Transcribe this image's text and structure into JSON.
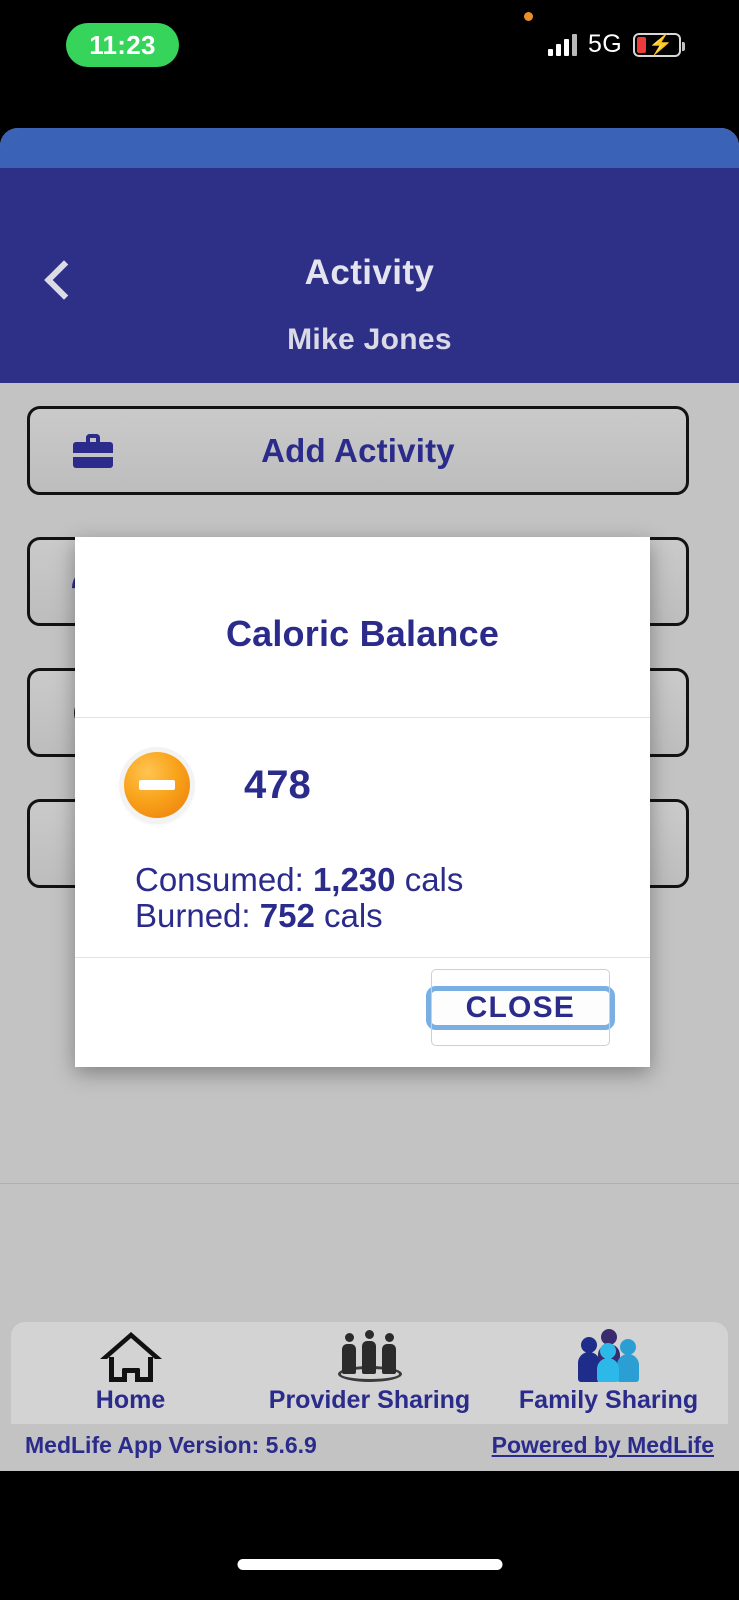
{
  "status_bar": {
    "time": "11:23",
    "network": "5G",
    "signal_icon": "signal-bars-icon",
    "battery_icon": "battery-charging-icon",
    "recording_indicator": "orange-dot-icon"
  },
  "header": {
    "back_icon": "back-chevron-icon",
    "title": "Activity",
    "subtitle": "Mike Jones"
  },
  "cards": [
    {
      "label": "Add Activity",
      "icon": "briefcase-icon"
    },
    {
      "label": "",
      "icon": "gauge-icon"
    },
    {
      "label": "",
      "icon": "circle-icon"
    },
    {
      "label": "",
      "icon": "vertical-dots-icon"
    }
  ],
  "dialog": {
    "title": "Caloric Balance",
    "status_icon": "minus-badge-icon",
    "balance_value": "478",
    "consumed_label": "Consumed:",
    "consumed_value": "1,230",
    "consumed_unit": "cals",
    "burned_label": "Burned:",
    "burned_value": "752",
    "burned_unit": "cals",
    "close_label": "CLOSE"
  },
  "bottom_nav": [
    {
      "label": "Home",
      "icon": "house-icon"
    },
    {
      "label": "Provider Sharing",
      "icon": "provider-group-icon"
    },
    {
      "label": "Family Sharing",
      "icon": "family-group-icon"
    }
  ],
  "footer": {
    "version": "MedLife App Version: 5.6.9",
    "powered_by": "Powered by MedLife"
  },
  "colors": {
    "brand_navy": "#2b2b8c",
    "header_bg": "#2e2f87",
    "header_strip": "#3a63b8",
    "page_bg": "#c3c3c3",
    "accent_orange": "#f9a31b",
    "focus_blue": "#79afe2",
    "time_pill_green": "#37d45c"
  }
}
